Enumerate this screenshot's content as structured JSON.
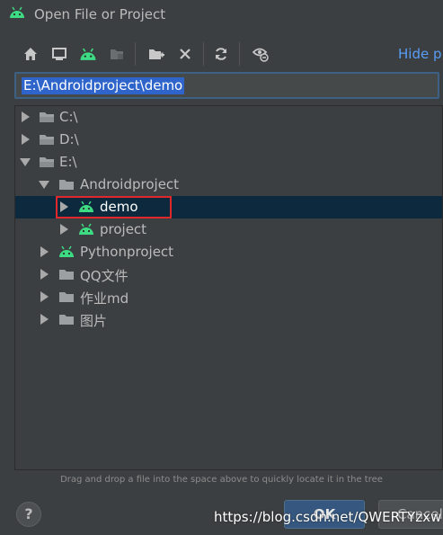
{
  "window": {
    "title": "Open File or Project"
  },
  "toolbar": {
    "buttons": [
      {
        "icon": "home-icon"
      },
      {
        "icon": "desktop-icon"
      },
      {
        "icon": "android-project-icon"
      },
      {
        "icon": "module-icon"
      },
      {
        "icon": "new-folder-icon"
      },
      {
        "icon": "delete-icon"
      },
      {
        "icon": "refresh-icon"
      },
      {
        "icon": "show-hidden-icon"
      }
    ],
    "hide_path_label": "Hide p"
  },
  "path_field": {
    "value": "E:\\Androidproject\\demo"
  },
  "tree": {
    "items": [
      {
        "label": "C:\\",
        "icon": "drive-icon",
        "state": "collapsed"
      },
      {
        "label": "D:\\",
        "icon": "drive-icon",
        "state": "collapsed"
      },
      {
        "label": "E:\\",
        "icon": "drive-icon",
        "state": "expanded"
      },
      {
        "label": "Androidproject",
        "icon": "folder-icon",
        "state": "expanded"
      },
      {
        "label": "demo",
        "icon": "android-icon",
        "state": "collapsed",
        "selected": true
      },
      {
        "label": "project",
        "icon": "android-icon",
        "state": "collapsed"
      },
      {
        "label": "Pythonproject",
        "icon": "android-icon",
        "state": "collapsed"
      },
      {
        "label": "QQ文件",
        "icon": "folder-icon",
        "state": "collapsed"
      },
      {
        "label": "作业md",
        "icon": "folder-icon",
        "state": "collapsed"
      },
      {
        "label": "图片",
        "icon": "folder-icon",
        "state": "collapsed"
      }
    ]
  },
  "hint": "Drag and drop a file into the space above to quickly locate it in the tree",
  "buttons": {
    "help": "?",
    "ok": "OK",
    "cancel": "Cancel"
  },
  "watermark": "https://blog.csdn.net/QWERTYzxw",
  "colors": {
    "background": "#3c3f41",
    "accent_link": "#589df6",
    "selection": "#0d293e",
    "android_green": "#3ddc84",
    "highlight_box": "#e0282c"
  }
}
